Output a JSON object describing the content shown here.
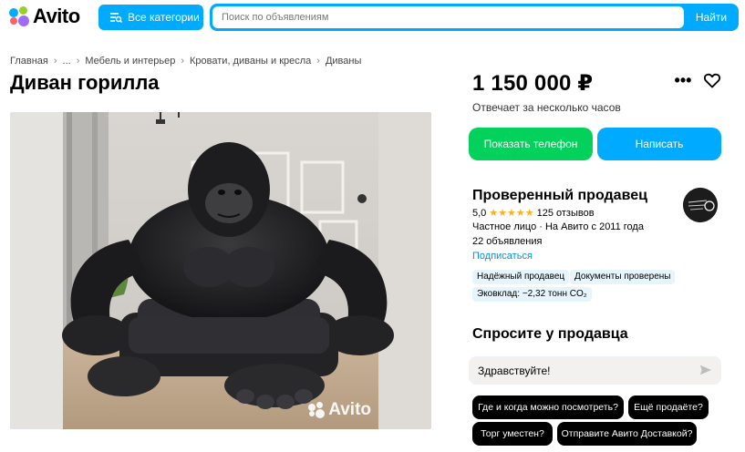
{
  "header": {
    "logo_text": "Avito",
    "categories_label": "Все категории",
    "search_placeholder": "Поиск по объявлениям",
    "search_button": "Найти",
    "brand_colors": {
      "blue": "#00aaff",
      "green": "#97cf26",
      "red": "#ff6163",
      "purple": "#a169f7"
    }
  },
  "breadcrumbs": [
    "Главная",
    "...",
    "Мебель и интерьер",
    "Кровати, диваны и кресла",
    "Диваны"
  ],
  "breadcrumb_separator": "›",
  "listing": {
    "title": "Диван горилла",
    "price": "1 150 000 ₽",
    "reply_time": "Отвечает за несколько часов",
    "image_watermark": "Avito",
    "image_subject": "sofa-shaped-as-gorilla-photo"
  },
  "actions": {
    "phone_button": "Показать телефон",
    "write_button": "Написать",
    "phone_color": "#02d15c",
    "write_color": "#00aaff"
  },
  "seller": {
    "title": "Проверенный продавец",
    "rating_value": "5,0",
    "stars": "★★★★★",
    "reviews": "125 отзывов",
    "type_line": "Частное лицо · На Авито с 2011 года",
    "ads_count": "22 объявления",
    "subscribe": "Подписаться",
    "badges": [
      "Надёжный продавец",
      "Документы проверены",
      "Эковклад: −2,32 тонн CO₂"
    ]
  },
  "ask": {
    "title": "Спросите у продавца",
    "message_value": "Здравствуйте!",
    "chips": [
      "Где и когда можно посмотреть?",
      "Ещё продаёте?",
      "Торг уместен?",
      "Отправите Авито Доставкой?"
    ]
  }
}
